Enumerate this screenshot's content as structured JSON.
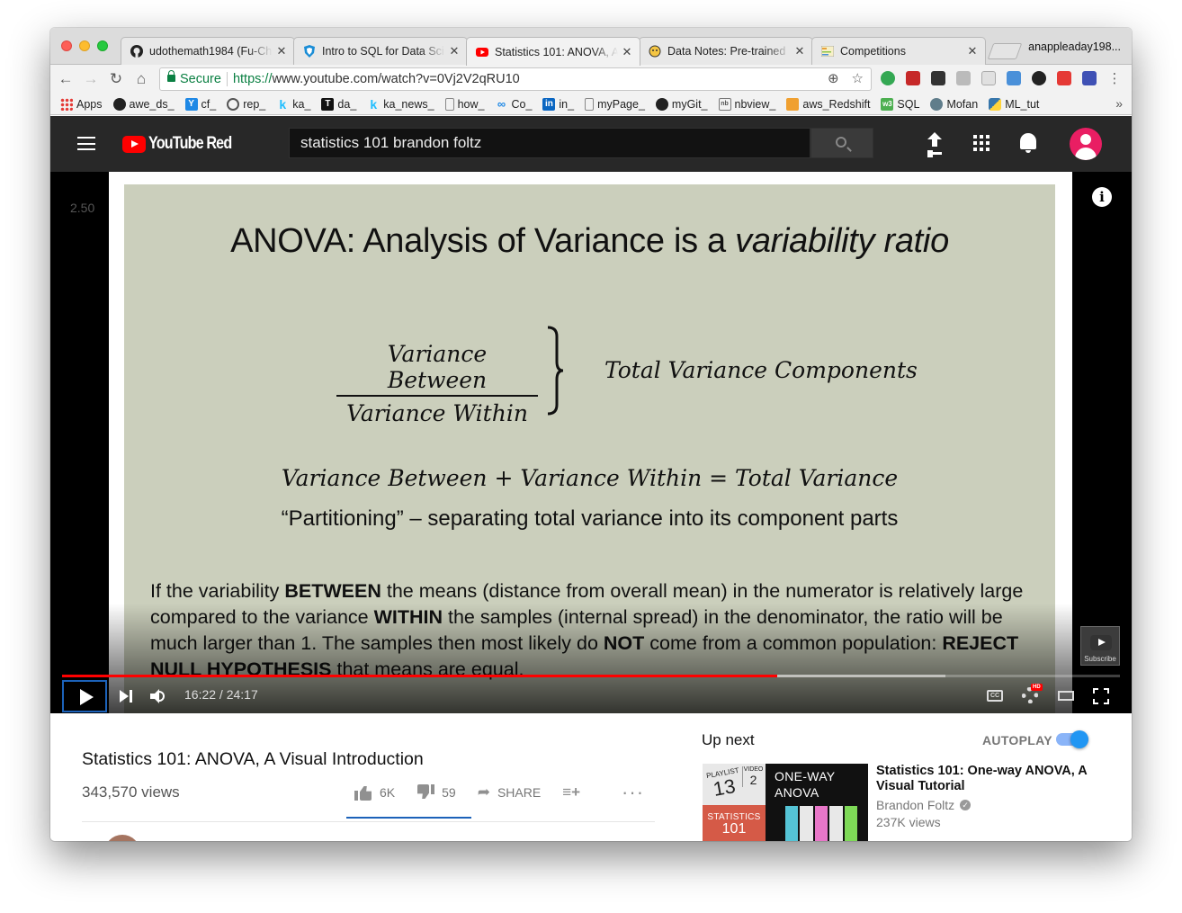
{
  "tabs": [
    {
      "label": "udothemath1984 (Fu-Ch",
      "icon": "github-icon",
      "active": false
    },
    {
      "label": "Intro to SQL for Data Sci",
      "icon": "datacamp-shield-icon",
      "active": false
    },
    {
      "label": "Statistics 101: ANOVA, A",
      "icon": "youtube-icon",
      "active": true
    },
    {
      "label": "Data Notes: Pre-trained",
      "icon": "kaggle-icon",
      "active": false
    },
    {
      "label": "Competitions",
      "icon": "competitions-icon",
      "active": false
    }
  ],
  "profile_name": "anappleaday198...",
  "omnibox": {
    "secure_label": "Secure",
    "url_scheme": "https://",
    "url_rest": "www.youtube.com/watch?v=0Vj2V2qRU10"
  },
  "bookmarks": [
    {
      "label": "Apps",
      "icon": "apps-grid-icon"
    },
    {
      "label": "awe_ds_",
      "icon": "github-icon"
    },
    {
      "label": "cf_",
      "icon": "cf-icon"
    },
    {
      "label": "rep_",
      "icon": "repo-icon"
    },
    {
      "label": "ka_",
      "icon": "kaggle-k-icon"
    },
    {
      "label": "da_",
      "icon": "t-icon"
    },
    {
      "label": "ka_news_",
      "icon": "kaggle-k-icon"
    },
    {
      "label": "how_",
      "icon": "page-icon"
    },
    {
      "label": "Co_",
      "icon": "infinity-icon"
    },
    {
      "label": "in_",
      "icon": "linkedin-icon"
    },
    {
      "label": "myPage_",
      "icon": "page-icon"
    },
    {
      "label": "myGit_",
      "icon": "github-icon"
    },
    {
      "label": "nbview_",
      "icon": "nbviewer-icon"
    },
    {
      "label": "aws_Redshift",
      "icon": "aws-icon"
    },
    {
      "label": "SQL",
      "icon": "w3-icon"
    },
    {
      "label": "Mofan",
      "icon": "mofan-icon"
    },
    {
      "label": "ML_tut",
      "icon": "python-icon"
    }
  ],
  "youtube": {
    "logo_text": "YouTube Red",
    "search_query": "statistics 101 brandon foltz"
  },
  "player": {
    "overlay_number": "2.50",
    "time": "16:22 / 24:17",
    "progress_fraction": 0.676,
    "buffer_fraction": 0.835,
    "subscribe_label": "Subscribe",
    "hd_badge": "HD",
    "cc_label": "CC"
  },
  "slide": {
    "title_plain": "ANOVA: Analysis of Variance is a ",
    "title_italic": "variability ratio",
    "fraction_num": "Variance Between",
    "fraction_den": "Variance Within",
    "total_components": "Total Variance Components",
    "equation": "Variance Between + Variance Within = Total Variance",
    "partition": "“Partitioning” – separating total variance into its component parts",
    "body": [
      {
        "t": "If the variability ",
        "b": false
      },
      {
        "t": "BETWEEN",
        "b": true
      },
      {
        "t": " the means (distance from overall mean) in the numerator is relatively large compared to the variance ",
        "b": false
      },
      {
        "t": "WITHIN",
        "b": true
      },
      {
        "t": " the samples (internal spread) in the denominator, the ratio will be much larger than 1. The samples then most likely do ",
        "b": false
      },
      {
        "t": "NOT",
        "b": true
      },
      {
        "t": " come from a common population: ",
        "b": false
      },
      {
        "t": "REJECT NULL HYPOTHESIS",
        "b": true
      },
      {
        "t": " that means are equal.",
        "b": false
      }
    ]
  },
  "video": {
    "title": "Statistics 101: ANOVA, A Visual Introduction",
    "views": "343,570 views",
    "likes": "6K",
    "dislikes": "59",
    "share_label": "SHARE"
  },
  "upnext": {
    "heading": "Up next",
    "autoplay_label": "AUTOPLAY",
    "autoplay_on": true,
    "title": "Statistics 101: One-way ANOVA, A Visual Tutorial",
    "channel": "Brandon Foltz",
    "views": "237K views",
    "thumb": {
      "playlist_label": "PLAYLIST",
      "playlist_num": "13",
      "video_label": "VIDEO",
      "video_num": "2",
      "stats_label": "STATISTICS",
      "stats_num": "101",
      "title_line1": "ONE-WAY",
      "title_line2": "ANOVA"
    }
  },
  "colors": {
    "youtube_red": "#ff0000",
    "yt_header_bg": "#282828",
    "slide_bg": "#cbcfbc",
    "secure_green": "#0b8043",
    "autoplay_blue": "#2196f3"
  }
}
